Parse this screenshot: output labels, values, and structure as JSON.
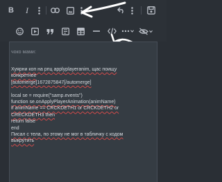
{
  "toolbar": {
    "row1_icons": [
      "bold-icon",
      "italic-icon",
      "more-vertical-icon",
      "link-icon",
      "image-icon",
      "more-vertical-icon",
      "undo-icon",
      "more-vertical-icon",
      "save-draft-icon"
    ],
    "row2_icons": [
      "emoji-icon",
      "media-icon",
      "quote-icon",
      "spoiler-icon",
      "table-icon",
      "horizontal-rule-icon",
      "code-icon",
      "more-options-icon",
      "preview-icon"
    ],
    "bold_label": "B",
    "italic_label": "I",
    "colors": {
      "background": "#2c3137",
      "icon": "#b9bec6",
      "annotation": "#ffffff"
    }
  },
  "editor": {
    "greeting": "чоко мами:",
    "lines": [
      "Хуярни коп на рпц applyplayeranim, щас поищу",
      "конкретнее",
      "[automerge]1672875847[/automerge]",
      "",
      "local se = require(\"samp.events\")",
      "function se.onApplyPlayerAnimation(animName)",
      "if animName == CRCKDETH1 or CRCKDETH2 or",
      "CRECKDETH3 then",
      "return false",
      "end",
      "Писал с тела, по этому не мог в табличку с кодом",
      "выкрутить"
    ]
  }
}
